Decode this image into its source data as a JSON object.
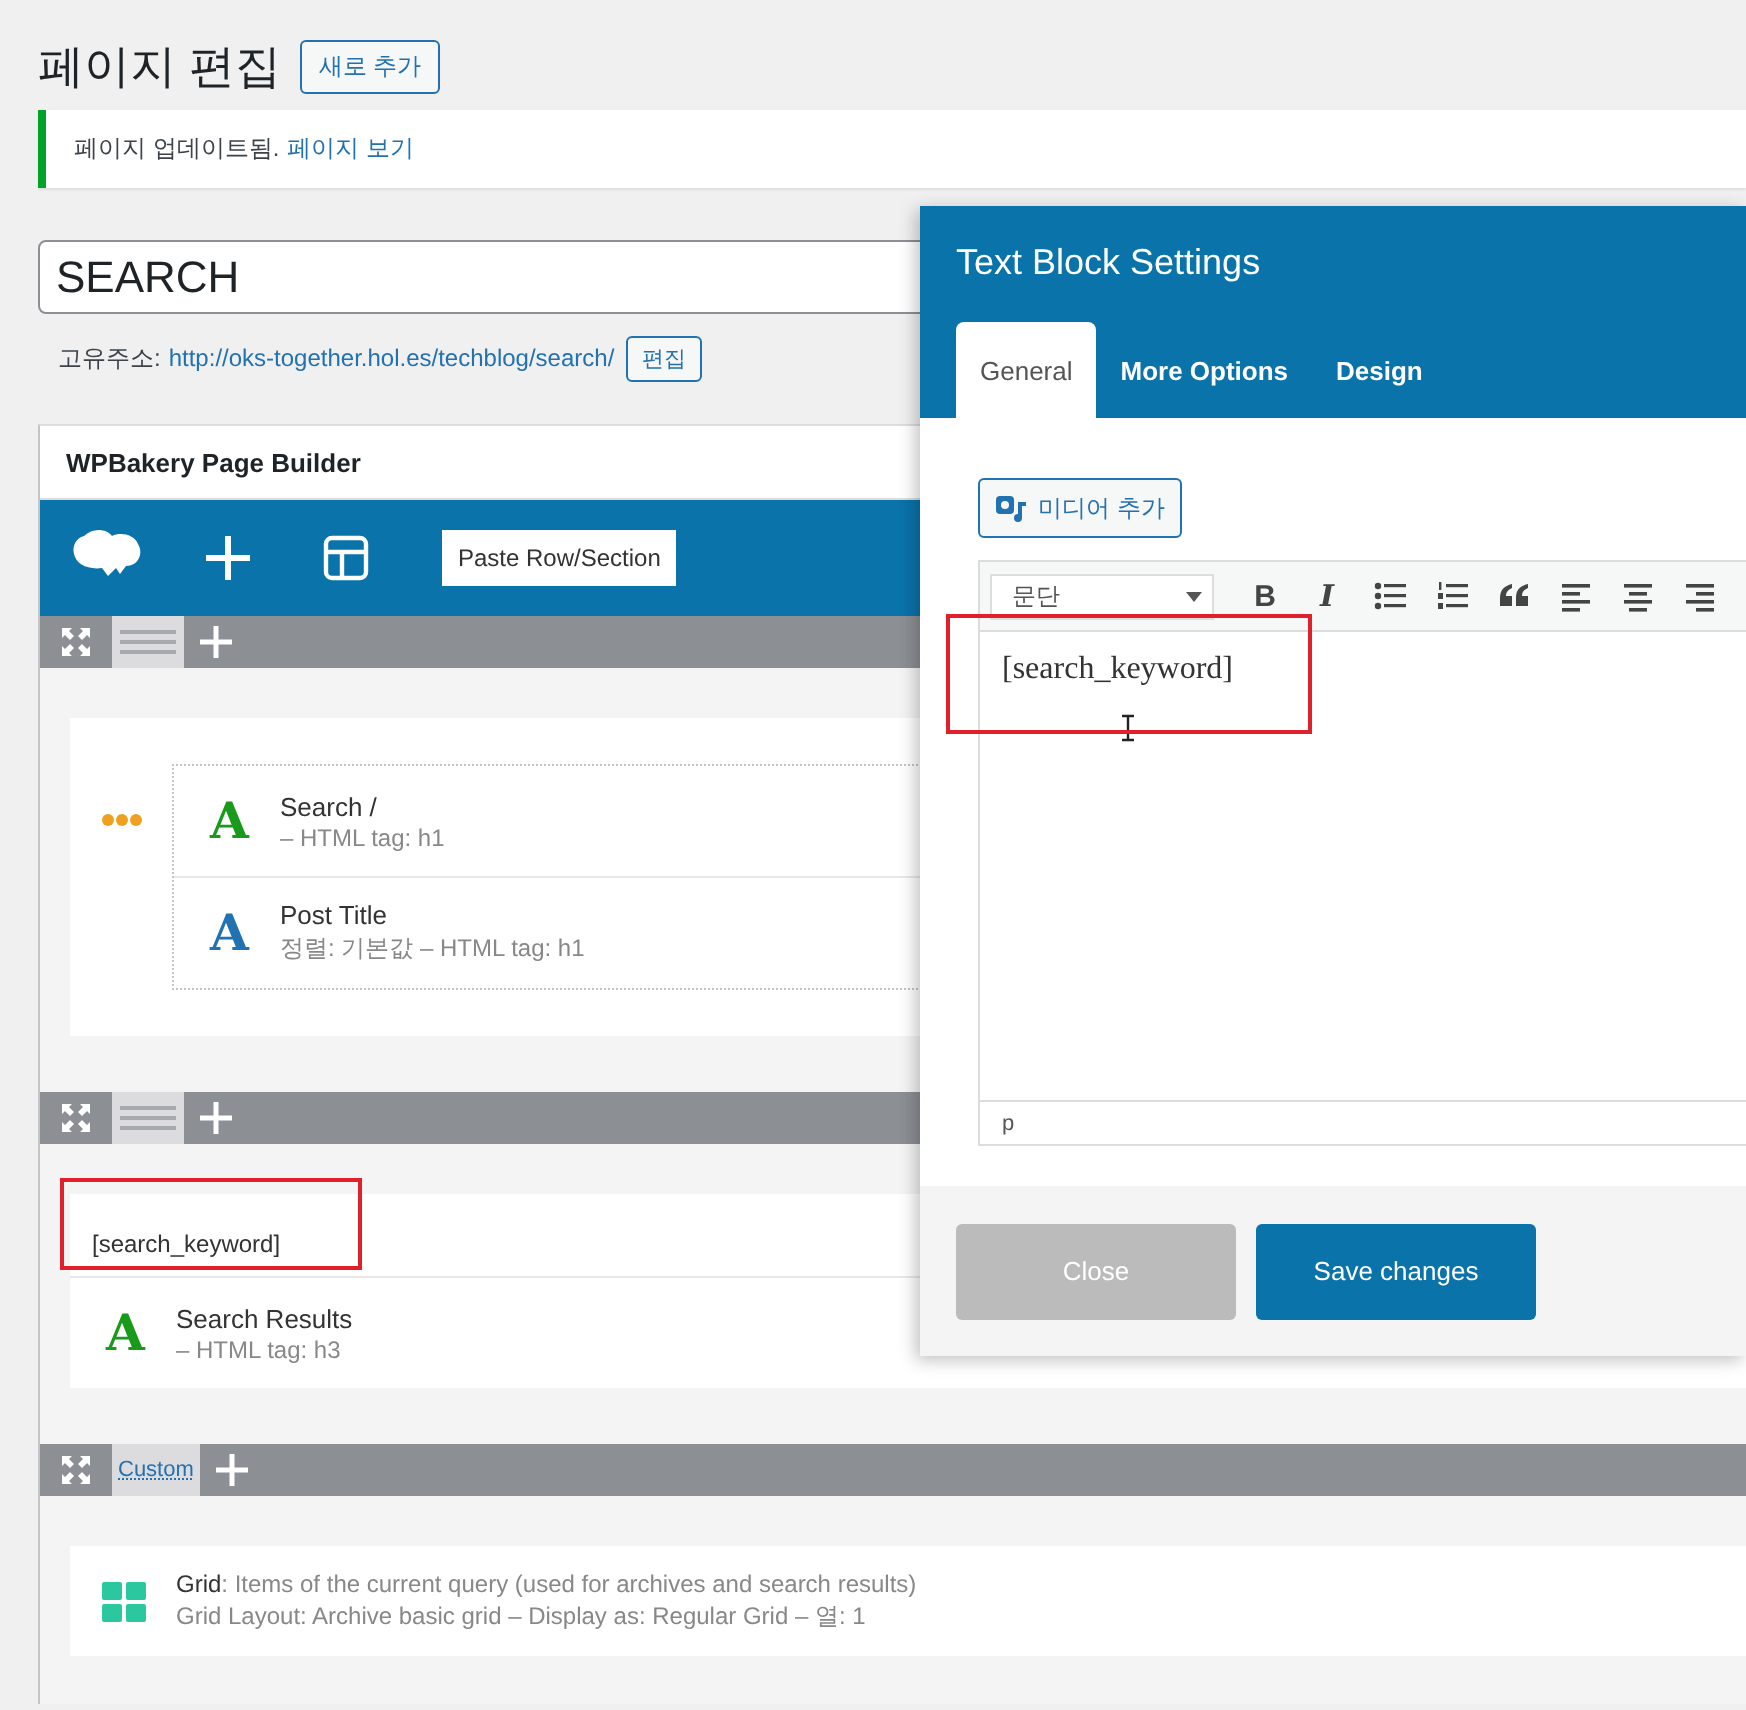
{
  "page": {
    "title": "페이지 편집",
    "add_new_button": "새로 추가"
  },
  "notice": {
    "message": "페이지 업데이트됨.",
    "link": "페이지 보기"
  },
  "title_field": {
    "value": "SEARCH"
  },
  "permalink": {
    "label": "고유주소:",
    "url": "http://oks-together.hol.es/techblog/search/",
    "edit_button": "편집"
  },
  "builder": {
    "title": "WPBakery Page Builder",
    "paste_button": "Paste Row/Section",
    "rows": [
      {
        "layout_label": null,
        "kind": "nested",
        "elements": [
          {
            "kind": "heading",
            "icon": "A",
            "color": "#1a9a1a",
            "name": "Search /",
            "meta": "– HTML tag: h1"
          },
          {
            "kind": "heading",
            "icon": "A",
            "color": "#2271b1",
            "name": "Post Title",
            "meta": "정렬: 기본값  – HTML tag: h1"
          }
        ]
      },
      {
        "layout_label": null,
        "kind": "plain",
        "elements": [
          {
            "kind": "text",
            "text": "[search_keyword]",
            "highlighted": true
          },
          {
            "kind": "heading",
            "icon": "A",
            "color": "#1a9a1a",
            "name": "Search Results",
            "meta": "– HTML tag: h3"
          }
        ]
      },
      {
        "layout_label": "Custom",
        "kind": "plain",
        "elements": [
          {
            "kind": "grid",
            "description": "**Grid**: Items of the current query (used for archives and search results)",
            "meta": "Grid Layout: Archive basic grid – Display as: Regular Grid – 열: 1"
          }
        ]
      }
    ]
  },
  "dialog": {
    "title": "Text Block Settings",
    "tabs": [
      {
        "label": "General",
        "selected": true
      },
      {
        "label": "More Options",
        "selected": false
      },
      {
        "label": "Design",
        "selected": false
      }
    ],
    "media_button": "미디어 추가",
    "format_select": "문단",
    "format_buttons": [
      "B",
      "I"
    ],
    "content": "[search_keyword]",
    "content_highlighted": true,
    "path": "p",
    "buttons": [
      {
        "label": "Close",
        "kind": "secondary"
      },
      {
        "label": "Save changes",
        "kind": "primary"
      }
    ]
  }
}
